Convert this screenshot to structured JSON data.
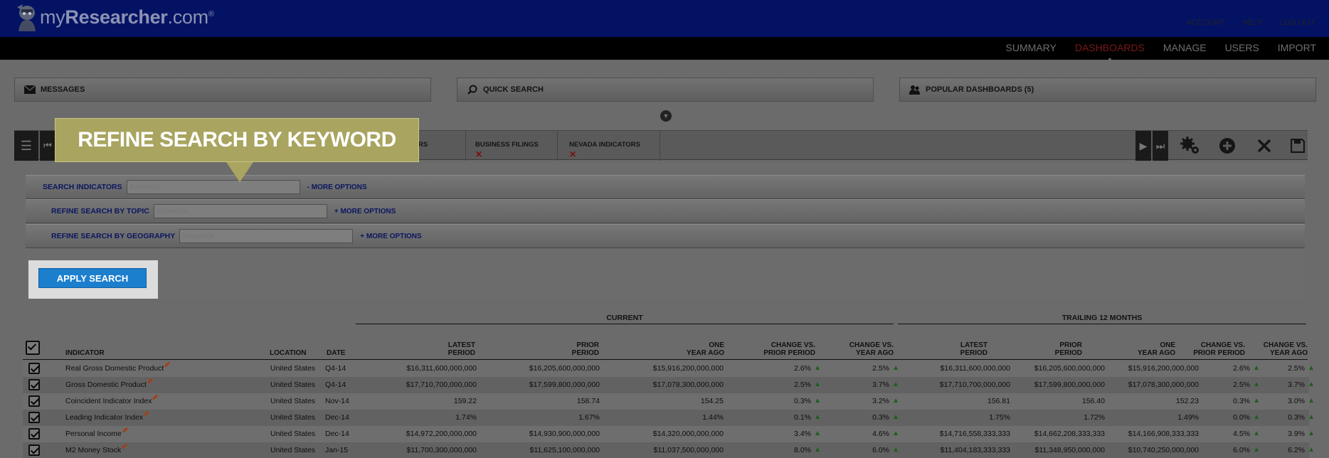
{
  "app": {
    "logo_pre": "my",
    "logo_bold": "Researcher",
    "logo_post": ".com",
    "logo_reg": "®"
  },
  "top_links": [
    "ACCOUNT",
    "HELP",
    "LOG OUT"
  ],
  "nav": {
    "items": [
      "SUMMARY",
      "DASHBOARDS",
      "MANAGE",
      "USERS",
      "IMPORT"
    ],
    "active": "DASHBOARDS"
  },
  "widgets": {
    "messages": "MESSAGES",
    "quick_search": "QUICK SEARCH",
    "popular": "POPULAR DASHBOARDS (5)"
  },
  "dashboard_tabs": [
    {
      "label": "TORS"
    },
    {
      "label": "BUSINESS FILINGS"
    },
    {
      "label": "NEVADA INDICATORS"
    }
  ],
  "callout": "REFINE SEARCH BY KEYWORD",
  "search": {
    "indicators_label": "SEARCH INDICATORS",
    "indicators_placeholder": "Keywords",
    "indicators_more": "- MORE OPTIONS",
    "topic_label": "REFINE SEARCH BY TOPIC",
    "topic_placeholder": "Keywords",
    "topic_more": "+ MORE OPTIONS",
    "geo_label": "REFINE SEARCH BY GEOGRAPHY",
    "geo_placeholder": "Keywords",
    "geo_more": "+ MORE OPTIONS",
    "apply": "APPLY SEARCH"
  },
  "table": {
    "group_current": "CURRENT",
    "group_trailing": "TRAILING 12 MONTHS",
    "headers": {
      "indicator": "INDICATOR",
      "location": "LOCATION",
      "date": "DATE",
      "latest_1": "LATEST",
      "latest_2": "PERIOD",
      "prior_1": "PRIOR",
      "prior_2": "PERIOD",
      "year_1": "ONE",
      "year_2": "YEAR AGO",
      "chg_prior_1": "CHANGE VS.",
      "chg_prior_2": "PRIOR PERIOD",
      "chg_year_1": "CHANGE VS.",
      "chg_year_2": "YEAR AGO"
    },
    "rows": [
      {
        "indicator": "Real Gross Domestic Product",
        "location": "United States",
        "date": "Q4-14",
        "latest": "$16,311,600,000,000",
        "prior": "$16,205,600,000,000",
        "year_ago": "$15,916,200,000,000",
        "chg_prior": "2.6%",
        "chg_year": "2.5%",
        "t_latest": "$16,311,600,000,000",
        "t_prior": "$16,205,600,000,000",
        "t_year_ago": "$15,916,200,000,000",
        "t_chg_prior": "2.6%",
        "t_chg_year": "2.5%"
      },
      {
        "indicator": "Gross Domestic Product",
        "location": "United States",
        "date": "Q4-14",
        "latest": "$17,710,700,000,000",
        "prior": "$17,599,800,000,000",
        "year_ago": "$17,078,300,000,000",
        "chg_prior": "2.5%",
        "chg_year": "3.7%",
        "t_latest": "$17,710,700,000,000",
        "t_prior": "$17,599,800,000,000",
        "t_year_ago": "$17,078,300,000,000",
        "t_chg_prior": "2.5%",
        "t_chg_year": "3.7%"
      },
      {
        "indicator": "Coincident Indicator Index",
        "location": "United States",
        "date": "Nov-14",
        "latest": "159.22",
        "prior": "158.74",
        "year_ago": "154.25",
        "chg_prior": "0.3%",
        "chg_year": "3.2%",
        "t_latest": "156.81",
        "t_prior": "156.40",
        "t_year_ago": "152.23",
        "t_chg_prior": "0.3%",
        "t_chg_year": "3.0%"
      },
      {
        "indicator": "Leading Indicator Index",
        "location": "United States",
        "date": "Dec-14",
        "latest": "1.74%",
        "prior": "1.67%",
        "year_ago": "1.44%",
        "chg_prior": "0.1%",
        "chg_year": "0.3%",
        "t_latest": "1.75%",
        "t_prior": "1.72%",
        "t_year_ago": "1.49%",
        "t_chg_prior": "0.0%",
        "t_chg_year": "0.3%"
      },
      {
        "indicator": "Personal Income",
        "location": "United States",
        "date": "Dec-14",
        "latest": "$14,972,200,000,000",
        "prior": "$14,930,900,000,000",
        "year_ago": "$14,320,000,000,000",
        "chg_prior": "3.4%",
        "chg_year": "4.6%",
        "t_latest": "$14,716,558,333,333",
        "t_prior": "$14,662,208,333,333",
        "t_year_ago": "$14,166,908,333,333",
        "t_chg_prior": "4.5%",
        "t_chg_year": "3.9%"
      },
      {
        "indicator": "M2 Money Stock",
        "location": "United States",
        "date": "Jan-15",
        "latest": "$11,700,300,000,000",
        "prior": "$11,625,100,000,000",
        "year_ago": "$11,037,500,000,000",
        "chg_prior": "8.0%",
        "chg_year": "6.0%",
        "t_latest": "$11,404,183,333,333",
        "t_prior": "$11,348,950,000,000",
        "t_year_ago": "$10,740,250,000,000",
        "t_chg_prior": "6.0%",
        "t_chg_year": "6.2%"
      }
    ]
  }
}
